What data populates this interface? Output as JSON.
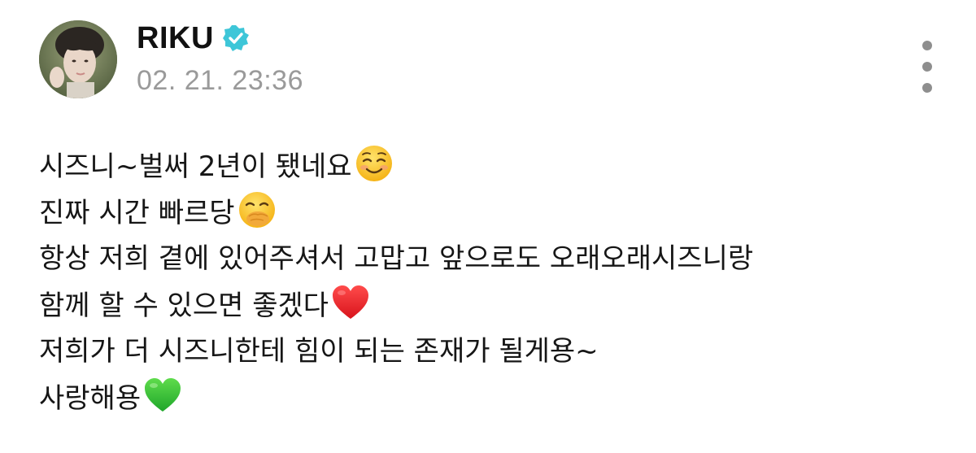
{
  "post": {
    "author": {
      "name": "RIKU",
      "verified": true
    },
    "timestamp": "02. 21. 23:36",
    "lines": [
      {
        "text": "시즈니~벌써 2년이 됐네요",
        "emoji": "smiling-face-icon"
      },
      {
        "text": "진짜 시간 빠르당",
        "emoji": "face-with-hand-over-mouth-icon"
      },
      {
        "text": "항상 저희 곁에 있어주셔서 고맙고 앞으로도 오래오래시즈니랑",
        "emoji": ""
      },
      {
        "text": "함께 할 수 있으면 좋겠다",
        "emoji": "red-heart-icon"
      },
      {
        "text": "저희가 더 시즈니한테 힘이 되는 존재가 될게용~",
        "emoji": ""
      },
      {
        "text": "사랑해용",
        "emoji": "green-heart-icon"
      }
    ]
  },
  "colors": {
    "verified_badge": "#3ec6d8",
    "timestamp": "#9a9a9a",
    "more_dots": "#8e8e8e"
  }
}
